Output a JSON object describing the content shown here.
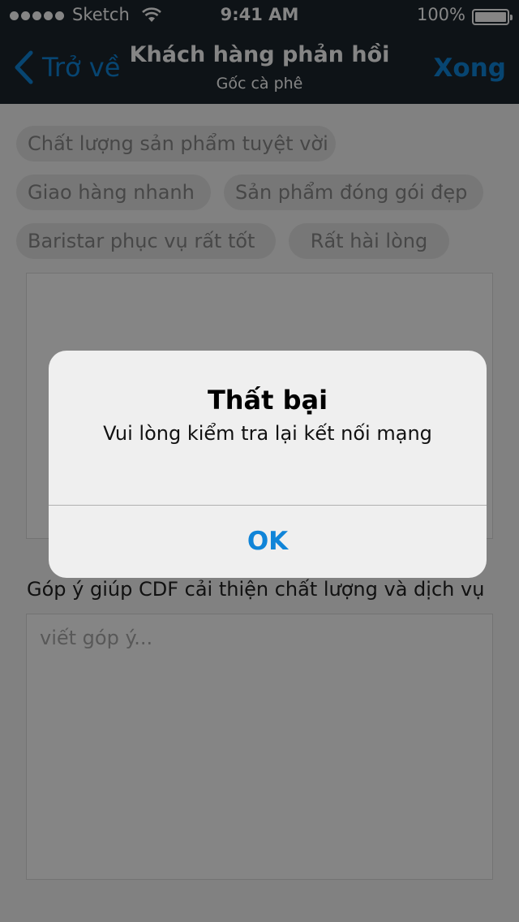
{
  "status_bar": {
    "carrier": "Sketch",
    "time": "9:41 AM",
    "battery": "100%"
  },
  "nav": {
    "back_label": "Trở về",
    "title": "Khách hàng phản hồi",
    "subtitle": "Gốc cà phê",
    "done_label": "Xong"
  },
  "tags": [
    "Chất lượng sản phẩm tuyệt vời",
    "Giao hàng nhanh",
    "Sản phẩm đóng gói đẹp",
    "Baristar phục vụ rất tốt",
    "Rất hài lòng"
  ],
  "feedback": {
    "label": "Góp ý giúp CDF cải thiện chất lượng và dịch vụ",
    "placeholder": "viết góp ý..."
  },
  "alert": {
    "title": "Thất bại",
    "message": "Vui lòng kiểm tra lại kết nối mạng",
    "ok_label": "OK"
  },
  "colors": {
    "nav_bg": "#1b252d",
    "accent": "#0f84d8",
    "alert_bg": "#efefef"
  }
}
